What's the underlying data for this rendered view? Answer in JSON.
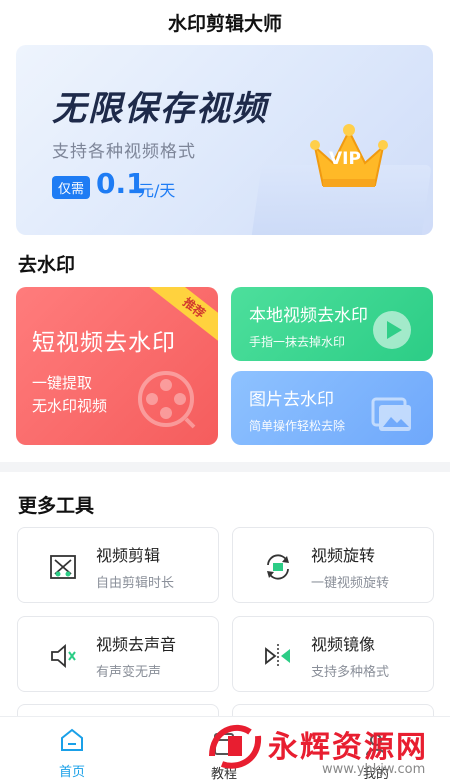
{
  "app": {
    "title": "水印剪辑大师"
  },
  "banner": {
    "headline": "无限保存视频",
    "subtitle": "支持各种视频格式",
    "price_prefix": "仅需",
    "price": "0.1",
    "price_unit": "元/天",
    "badge": "VIP"
  },
  "watermark_section": {
    "title": "去水印",
    "short_video": {
      "title": "短视频去水印",
      "line1": "一键提取",
      "line2": "无水印视频",
      "ribbon": "推荐"
    },
    "local_video": {
      "title": "本地视频去水印",
      "subtitle": "手指一抹去掉水印"
    },
    "image": {
      "title": "图片去水印",
      "subtitle": "简单操作轻松去除"
    }
  },
  "tools_section": {
    "title": "更多工具",
    "items": [
      {
        "name": "视频剪辑",
        "desc": "自由剪辑时长",
        "icon": "scissors-icon"
      },
      {
        "name": "视频旋转",
        "desc": "一键视频旋转",
        "icon": "rotate-icon"
      },
      {
        "name": "视频去声音",
        "desc": "有声变无声",
        "icon": "mute-icon"
      },
      {
        "name": "视频镜像",
        "desc": "支持多种格式",
        "icon": "mirror-icon"
      }
    ]
  },
  "bottom_nav": {
    "items": [
      {
        "label": "首页",
        "icon": "home-icon",
        "active": true
      },
      {
        "label": "教程",
        "icon": "book-icon",
        "active": false
      },
      {
        "label": "我的",
        "icon": "user-icon",
        "active": false
      }
    ]
  },
  "watermark_overlay": {
    "text": "永辉资源网",
    "url": "www.yhkjw.com"
  },
  "colors": {
    "accent": "#1e7cf4",
    "red_card": "#f55d5d",
    "green_card": "#2ccd86",
    "blue_card": "#6fa8fb",
    "nav_active": "#1aa0e8"
  }
}
